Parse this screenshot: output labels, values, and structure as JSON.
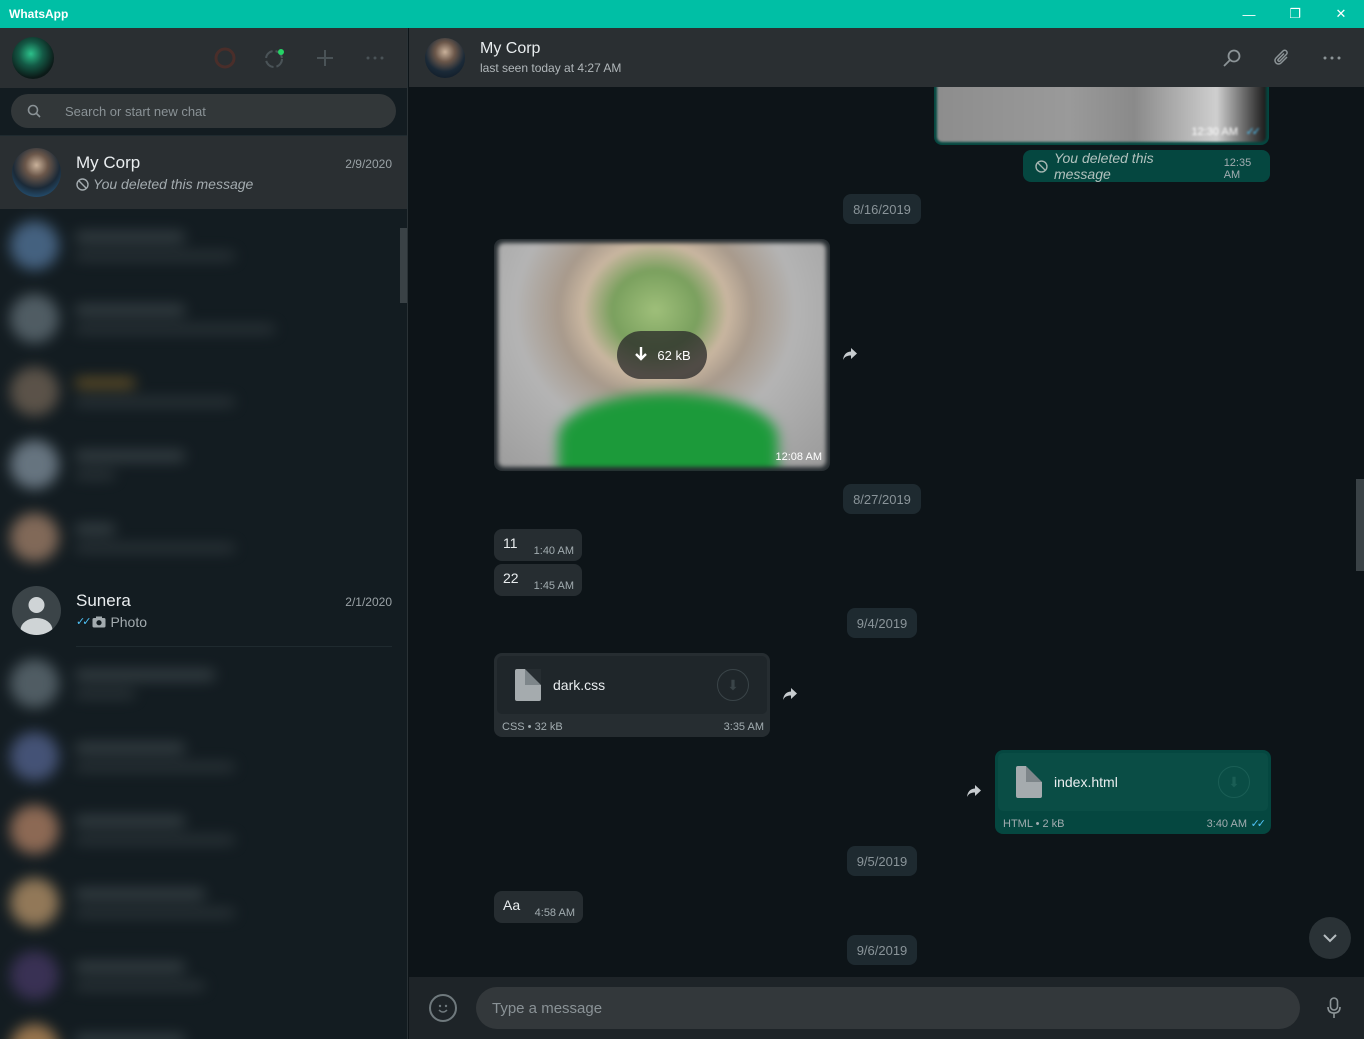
{
  "window": {
    "title": "WhatsApp",
    "minimize": "—",
    "restore": "❐",
    "close": "✕"
  },
  "sidebar": {
    "search_placeholder": "Search or start new chat",
    "chats": [
      {
        "name": "My Corp",
        "date": "2/9/2020",
        "preview": "You deleted this message"
      },
      {
        "name": "Sunera",
        "date": "2/1/2020",
        "preview": "Photo"
      }
    ]
  },
  "chat": {
    "name": "My Corp",
    "status": "last seen today at 4:27 AM",
    "messages": {
      "img_top_time": "12:30 AM",
      "deleted_text": "You deleted this message",
      "deleted_time": "12:35 AM",
      "date1": "8/16/2019",
      "image_size": "62 kB",
      "image_time": "12:08 AM",
      "date2": "8/27/2019",
      "msg11_text": "11",
      "msg11_time": "1:40 AM",
      "msg22_text": "22",
      "msg22_time": "1:45 AM",
      "date3": "9/4/2019",
      "doc1_name": "dark.css",
      "doc1_meta": "CSS • 32 kB",
      "doc1_time": "3:35 AM",
      "doc2_name": "index.html",
      "doc2_meta": "HTML • 2 kB",
      "doc2_time": "3:40 AM",
      "date4": "9/5/2019",
      "msgAa_text": "Aa",
      "msgAa_time": "4:58 AM",
      "date5": "9/6/2019"
    }
  },
  "composer": {
    "placeholder": "Type a message"
  },
  "colors": {
    "titlebar": "#00bfa5",
    "outgoing": "#054740",
    "incoming": "#262d31",
    "read_ticks": "#4fc3f7"
  }
}
